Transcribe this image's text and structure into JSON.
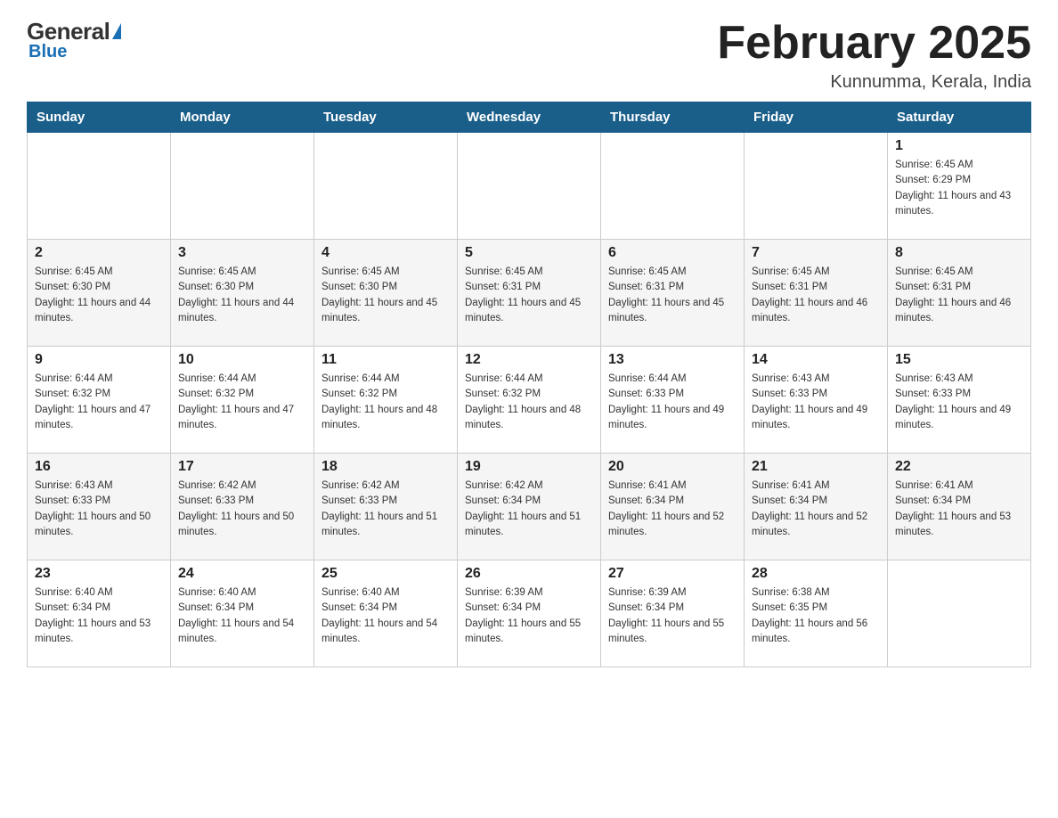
{
  "header": {
    "logo_general": "General",
    "logo_blue": "Blue",
    "month_title": "February 2025",
    "location": "Kunnumma, Kerala, India"
  },
  "days_of_week": [
    "Sunday",
    "Monday",
    "Tuesday",
    "Wednesday",
    "Thursday",
    "Friday",
    "Saturday"
  ],
  "weeks": [
    [
      {
        "day": "",
        "sunrise": "",
        "sunset": "",
        "daylight": ""
      },
      {
        "day": "",
        "sunrise": "",
        "sunset": "",
        "daylight": ""
      },
      {
        "day": "",
        "sunrise": "",
        "sunset": "",
        "daylight": ""
      },
      {
        "day": "",
        "sunrise": "",
        "sunset": "",
        "daylight": ""
      },
      {
        "day": "",
        "sunrise": "",
        "sunset": "",
        "daylight": ""
      },
      {
        "day": "",
        "sunrise": "",
        "sunset": "",
        "daylight": ""
      },
      {
        "day": "1",
        "sunrise": "Sunrise: 6:45 AM",
        "sunset": "Sunset: 6:29 PM",
        "daylight": "Daylight: 11 hours and 43 minutes."
      }
    ],
    [
      {
        "day": "2",
        "sunrise": "Sunrise: 6:45 AM",
        "sunset": "Sunset: 6:30 PM",
        "daylight": "Daylight: 11 hours and 44 minutes."
      },
      {
        "day": "3",
        "sunrise": "Sunrise: 6:45 AM",
        "sunset": "Sunset: 6:30 PM",
        "daylight": "Daylight: 11 hours and 44 minutes."
      },
      {
        "day": "4",
        "sunrise": "Sunrise: 6:45 AM",
        "sunset": "Sunset: 6:30 PM",
        "daylight": "Daylight: 11 hours and 45 minutes."
      },
      {
        "day": "5",
        "sunrise": "Sunrise: 6:45 AM",
        "sunset": "Sunset: 6:31 PM",
        "daylight": "Daylight: 11 hours and 45 minutes."
      },
      {
        "day": "6",
        "sunrise": "Sunrise: 6:45 AM",
        "sunset": "Sunset: 6:31 PM",
        "daylight": "Daylight: 11 hours and 45 minutes."
      },
      {
        "day": "7",
        "sunrise": "Sunrise: 6:45 AM",
        "sunset": "Sunset: 6:31 PM",
        "daylight": "Daylight: 11 hours and 46 minutes."
      },
      {
        "day": "8",
        "sunrise": "Sunrise: 6:45 AM",
        "sunset": "Sunset: 6:31 PM",
        "daylight": "Daylight: 11 hours and 46 minutes."
      }
    ],
    [
      {
        "day": "9",
        "sunrise": "Sunrise: 6:44 AM",
        "sunset": "Sunset: 6:32 PM",
        "daylight": "Daylight: 11 hours and 47 minutes."
      },
      {
        "day": "10",
        "sunrise": "Sunrise: 6:44 AM",
        "sunset": "Sunset: 6:32 PM",
        "daylight": "Daylight: 11 hours and 47 minutes."
      },
      {
        "day": "11",
        "sunrise": "Sunrise: 6:44 AM",
        "sunset": "Sunset: 6:32 PM",
        "daylight": "Daylight: 11 hours and 48 minutes."
      },
      {
        "day": "12",
        "sunrise": "Sunrise: 6:44 AM",
        "sunset": "Sunset: 6:32 PM",
        "daylight": "Daylight: 11 hours and 48 minutes."
      },
      {
        "day": "13",
        "sunrise": "Sunrise: 6:44 AM",
        "sunset": "Sunset: 6:33 PM",
        "daylight": "Daylight: 11 hours and 49 minutes."
      },
      {
        "day": "14",
        "sunrise": "Sunrise: 6:43 AM",
        "sunset": "Sunset: 6:33 PM",
        "daylight": "Daylight: 11 hours and 49 minutes."
      },
      {
        "day": "15",
        "sunrise": "Sunrise: 6:43 AM",
        "sunset": "Sunset: 6:33 PM",
        "daylight": "Daylight: 11 hours and 49 minutes."
      }
    ],
    [
      {
        "day": "16",
        "sunrise": "Sunrise: 6:43 AM",
        "sunset": "Sunset: 6:33 PM",
        "daylight": "Daylight: 11 hours and 50 minutes."
      },
      {
        "day": "17",
        "sunrise": "Sunrise: 6:42 AM",
        "sunset": "Sunset: 6:33 PM",
        "daylight": "Daylight: 11 hours and 50 minutes."
      },
      {
        "day": "18",
        "sunrise": "Sunrise: 6:42 AM",
        "sunset": "Sunset: 6:33 PM",
        "daylight": "Daylight: 11 hours and 51 minutes."
      },
      {
        "day": "19",
        "sunrise": "Sunrise: 6:42 AM",
        "sunset": "Sunset: 6:34 PM",
        "daylight": "Daylight: 11 hours and 51 minutes."
      },
      {
        "day": "20",
        "sunrise": "Sunrise: 6:41 AM",
        "sunset": "Sunset: 6:34 PM",
        "daylight": "Daylight: 11 hours and 52 minutes."
      },
      {
        "day": "21",
        "sunrise": "Sunrise: 6:41 AM",
        "sunset": "Sunset: 6:34 PM",
        "daylight": "Daylight: 11 hours and 52 minutes."
      },
      {
        "day": "22",
        "sunrise": "Sunrise: 6:41 AM",
        "sunset": "Sunset: 6:34 PM",
        "daylight": "Daylight: 11 hours and 53 minutes."
      }
    ],
    [
      {
        "day": "23",
        "sunrise": "Sunrise: 6:40 AM",
        "sunset": "Sunset: 6:34 PM",
        "daylight": "Daylight: 11 hours and 53 minutes."
      },
      {
        "day": "24",
        "sunrise": "Sunrise: 6:40 AM",
        "sunset": "Sunset: 6:34 PM",
        "daylight": "Daylight: 11 hours and 54 minutes."
      },
      {
        "day": "25",
        "sunrise": "Sunrise: 6:40 AM",
        "sunset": "Sunset: 6:34 PM",
        "daylight": "Daylight: 11 hours and 54 minutes."
      },
      {
        "day": "26",
        "sunrise": "Sunrise: 6:39 AM",
        "sunset": "Sunset: 6:34 PM",
        "daylight": "Daylight: 11 hours and 55 minutes."
      },
      {
        "day": "27",
        "sunrise": "Sunrise: 6:39 AM",
        "sunset": "Sunset: 6:34 PM",
        "daylight": "Daylight: 11 hours and 55 minutes."
      },
      {
        "day": "28",
        "sunrise": "Sunrise: 6:38 AM",
        "sunset": "Sunset: 6:35 PM",
        "daylight": "Daylight: 11 hours and 56 minutes."
      },
      {
        "day": "",
        "sunrise": "",
        "sunset": "",
        "daylight": ""
      }
    ]
  ]
}
